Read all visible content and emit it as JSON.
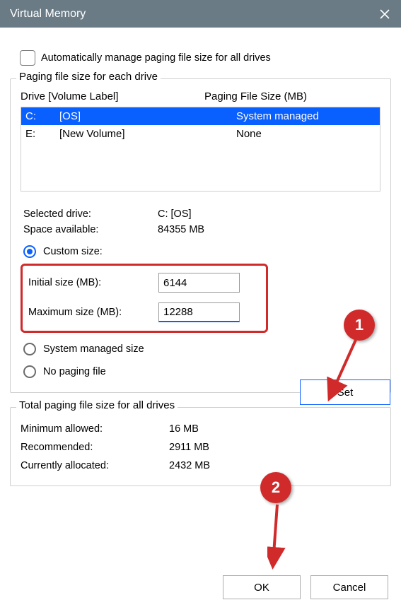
{
  "window": {
    "title": "Virtual Memory"
  },
  "auto_manage": {
    "label": "Automatically manage paging file size for all drives",
    "checked": false
  },
  "drives_group": {
    "legend": "Paging file size for each drive",
    "col_drive": "Drive  [Volume Label]",
    "col_size": "Paging File Size (MB)",
    "rows": [
      {
        "letter": "C:",
        "label": "[OS]",
        "size": "System managed",
        "selected": true
      },
      {
        "letter": "E:",
        "label": "[New Volume]",
        "size": "None",
        "selected": false
      }
    ]
  },
  "selected": {
    "drive_label": "Selected drive:",
    "drive_value": "C:  [OS]",
    "space_label": "Space available:",
    "space_value": "84355 MB"
  },
  "options": {
    "custom": {
      "label": "Custom size:",
      "checked": true
    },
    "initial_label": "Initial size (MB):",
    "initial_value": "6144",
    "max_label": "Maximum size (MB):",
    "max_value": "12288",
    "system": {
      "label": "System managed size",
      "checked": false
    },
    "none": {
      "label": "No paging file",
      "checked": false
    },
    "set_btn": "Set"
  },
  "totals_group": {
    "legend": "Total paging file size for all drives",
    "min_label": "Minimum allowed:",
    "min_value": "16 MB",
    "rec_label": "Recommended:",
    "rec_value": "2911 MB",
    "cur_label": "Currently allocated:",
    "cur_value": "2432 MB"
  },
  "buttons": {
    "ok": "OK",
    "cancel": "Cancel"
  },
  "annotations": {
    "one": "1",
    "two": "2"
  }
}
